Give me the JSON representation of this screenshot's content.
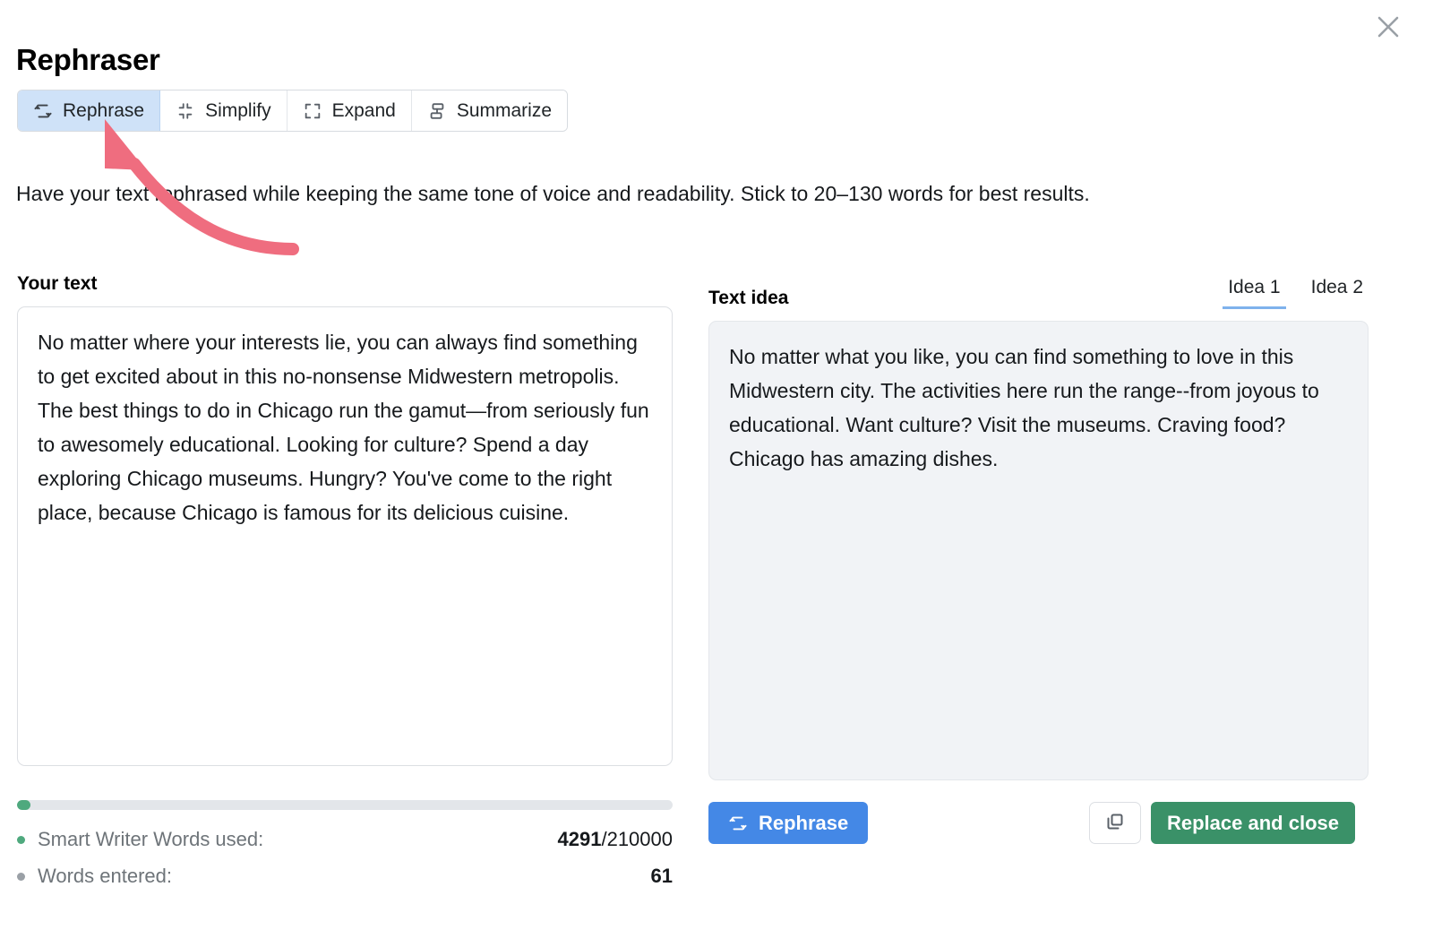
{
  "header": {
    "title": "Rephraser",
    "close_icon": "close-icon"
  },
  "mode_tabs": [
    {
      "label": "Rephrase",
      "icon": "repeat-icon",
      "active": true
    },
    {
      "label": "Simplify",
      "icon": "collapse-icon",
      "active": false
    },
    {
      "label": "Expand",
      "icon": "expand-icon",
      "active": false
    },
    {
      "label": "Summarize",
      "icon": "summarize-icon",
      "active": false
    }
  ],
  "description": "Have your text rephrased while keeping the same tone of voice and readability. Stick to 20–130 words for best results.",
  "left_panel": {
    "label": "Your text",
    "value": "No matter where your interests lie, you can always find something to get excited about in this no-nonsense Midwestern metropolis. The best things to do in Chicago run the gamut—from seriously fun to awesomely educational. Looking for culture? Spend a day exploring Chicago museums. Hungry? You've come to the right place, because Chicago is famous for its delicious cuisine.",
    "placeholder": "Your text"
  },
  "right_panel": {
    "label": "Text idea",
    "idea_tabs": [
      {
        "label": "Idea 1",
        "active": true
      },
      {
        "label": "Idea 2",
        "active": false
      }
    ],
    "value": "No matter what you like, you can find something to love in this Midwestern city. The activities here run the range--from joyous to educational. Want culture? Visit the museums. Craving food? Chicago has amazing dishes."
  },
  "usage": {
    "progress_percent": 2,
    "words_used": {
      "label": "Smart Writer Words used:",
      "used": "4291",
      "separator": "/",
      "total": "210000",
      "dot_color": "#4fa97e"
    },
    "words_entered": {
      "label": "Words entered:",
      "value": "61",
      "dot_color": "#9aa0a6"
    }
  },
  "actions": {
    "rephrase": {
      "label": "Rephrase",
      "icon": "repeat-icon",
      "color": "#4488e6"
    },
    "copy": {
      "icon": "copy-icon"
    },
    "replace_and_close": {
      "label": "Replace and close",
      "color": "#3a9168"
    }
  },
  "annotation": {
    "type": "curved-arrow",
    "color": "#ef6d7f",
    "points_to": "Rephrase"
  }
}
